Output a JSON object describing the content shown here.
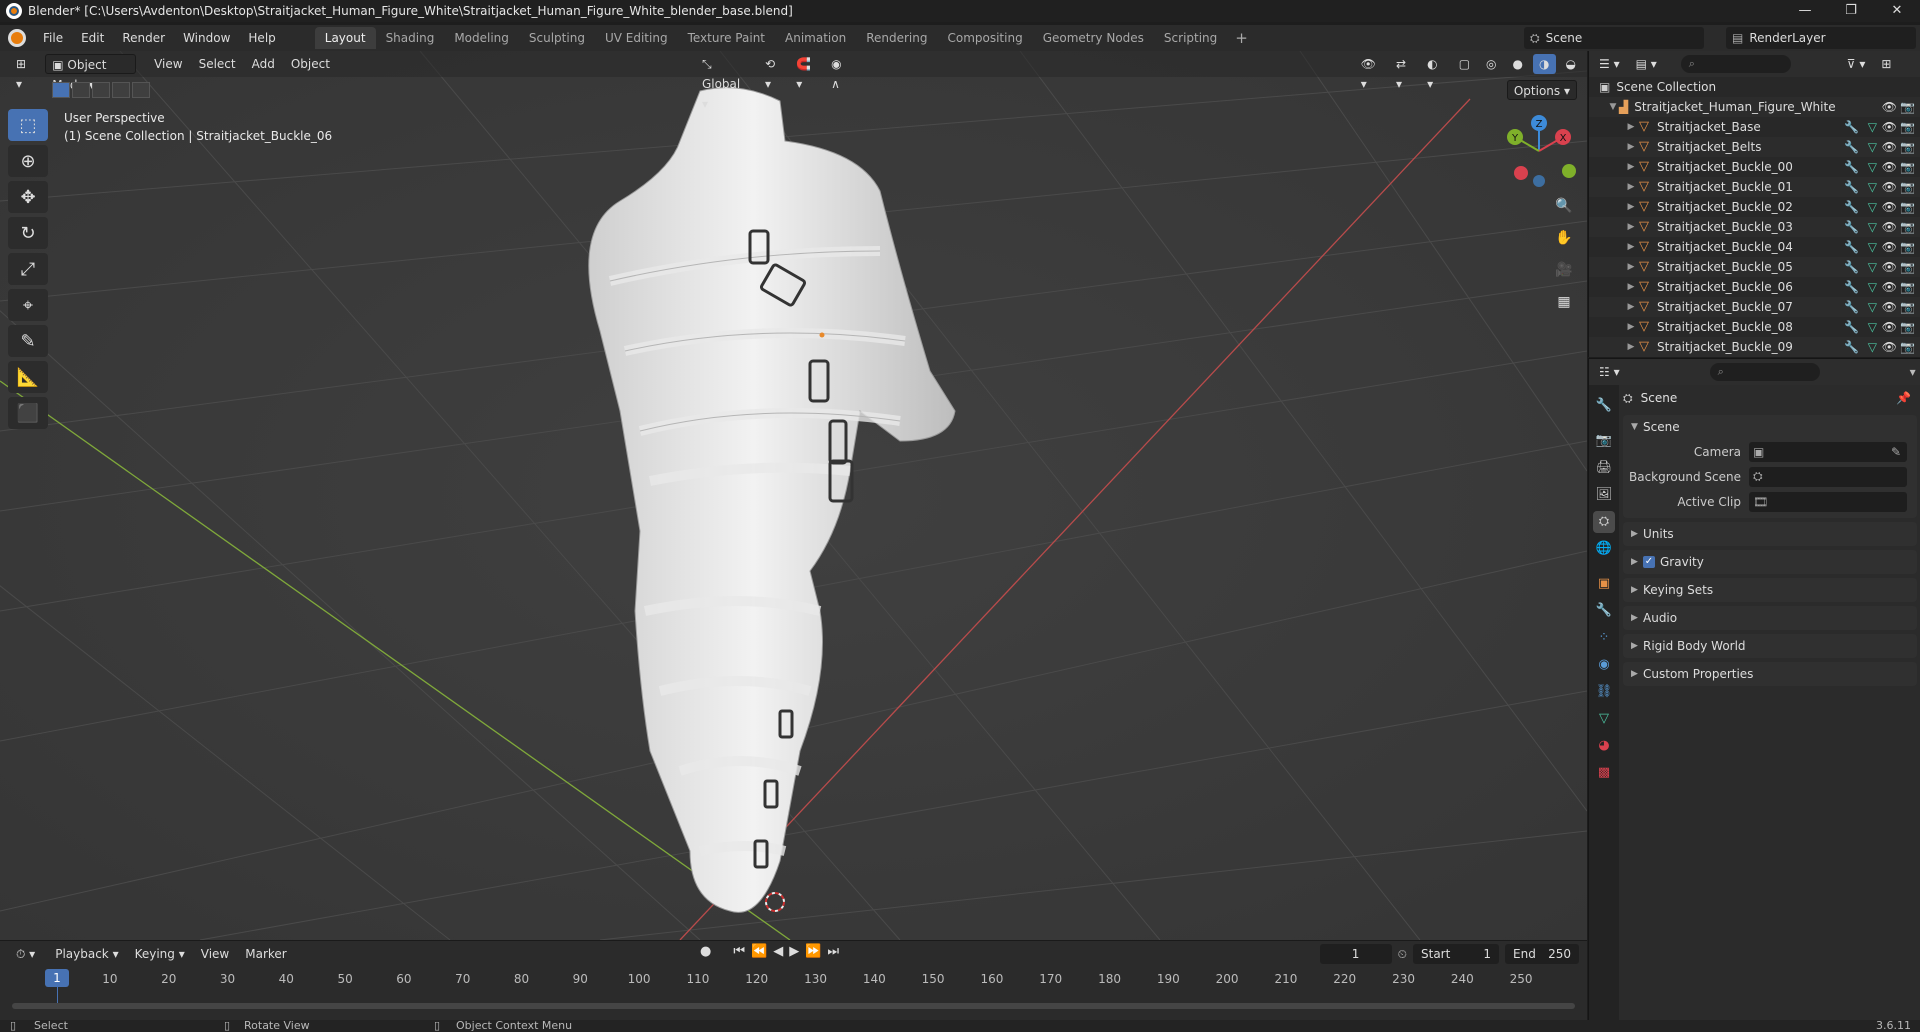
{
  "window": {
    "title": "Blender* [C:\\Users\\Avdenton\\Desktop\\Straitjacket_Human_Figure_White\\Straitjacket_Human_Figure_White_blender_base.blend]",
    "minimize": "—",
    "maximize": "❐",
    "close": "✕"
  },
  "menus": [
    "File",
    "Edit",
    "Render",
    "Window",
    "Help"
  ],
  "workspaces": [
    {
      "label": "Layout",
      "active": true
    },
    {
      "label": "Shading"
    },
    {
      "label": "Modeling"
    },
    {
      "label": "Sculpting"
    },
    {
      "label": "UV Editing"
    },
    {
      "label": "Texture Paint"
    },
    {
      "label": "Animation"
    },
    {
      "label": "Rendering"
    },
    {
      "label": "Compositing"
    },
    {
      "label": "Geometry Nodes"
    },
    {
      "label": "Scripting"
    }
  ],
  "workspace_add": "+",
  "scene_selector": "Scene",
  "view_layer_selector": "RenderLayer",
  "viewport": {
    "mode": "Object Mode",
    "menus": [
      "View",
      "Select",
      "Add",
      "Object"
    ],
    "transform_orientation": "Global",
    "options": "Options",
    "perspective_label": "User Perspective",
    "context_label": "(1) Scene Collection | Straitjacket_Buckle_06",
    "gizmo_axes": {
      "x": "X",
      "y": "Y",
      "z": "Z"
    }
  },
  "timeline": {
    "menus": [
      "Playback",
      "Keying",
      "View",
      "Marker"
    ],
    "current_frame": "1",
    "start_label": "Start",
    "start_value": "1",
    "end_label": "End",
    "end_value": "250",
    "ruler_ticks": [
      "10",
      "20",
      "30",
      "40",
      "50",
      "60",
      "70",
      "80",
      "90",
      "100",
      "110",
      "120",
      "130",
      "140",
      "150",
      "160",
      "170",
      "180",
      "190",
      "200",
      "210",
      "220",
      "230",
      "240",
      "250"
    ],
    "playhead": "1"
  },
  "statusbar": {
    "select": "Select",
    "rotate": "Rotate View",
    "context_menu": "Object Context Menu",
    "version": "3.6.11"
  },
  "outliner": {
    "root": "Scene Collection",
    "collection": "Straitjacket_Human_Figure_White",
    "items": [
      "Straitjacket_Base",
      "Straitjacket_Belts",
      "Straitjacket_Buckle_00",
      "Straitjacket_Buckle_01",
      "Straitjacket_Buckle_02",
      "Straitjacket_Buckle_03",
      "Straitjacket_Buckle_04",
      "Straitjacket_Buckle_05",
      "Straitjacket_Buckle_06",
      "Straitjacket_Buckle_07",
      "Straitjacket_Buckle_08",
      "Straitjacket_Buckle_09"
    ]
  },
  "properties": {
    "context": "Scene",
    "scene_panel": "Scene",
    "camera_label": "Camera",
    "background_scene_label": "Background Scene",
    "active_clip_label": "Active Clip",
    "panels": [
      "Units",
      "Gravity",
      "Keying Sets",
      "Audio",
      "Rigid Body World",
      "Custom Properties"
    ]
  },
  "colors": {
    "accent": "#4772b3",
    "object_orange": "#e69147",
    "x_axis": "#d9414e",
    "y_axis": "#7fb02a",
    "z_axis": "#3d8bd9"
  }
}
